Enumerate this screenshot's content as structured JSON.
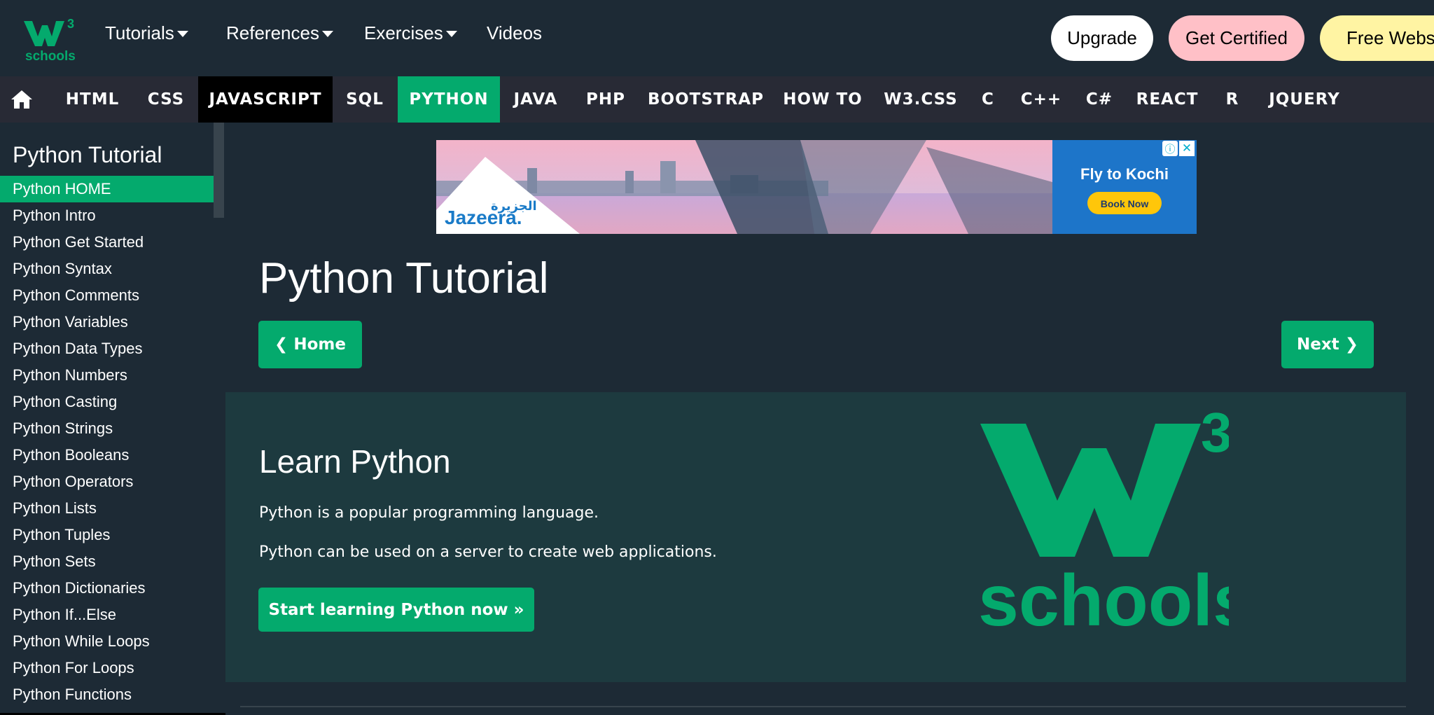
{
  "brand": {
    "logo_text": "schools",
    "logo_sup": "3",
    "logo_letter": "W",
    "accent": "#04aa6d"
  },
  "topnav": {
    "tutorials": "Tutorials",
    "references": "References",
    "exercises": "Exercises",
    "videos": "Videos",
    "upgrade": "Upgrade",
    "get_certified": "Get Certified",
    "free_website": "Free Websi"
  },
  "subnav": {
    "home_icon": "home-icon",
    "items": [
      "HTML",
      "CSS",
      "JAVASCRIPT",
      "SQL",
      "PYTHON",
      "JAVA",
      "PHP",
      "BOOTSTRAP",
      "HOW TO",
      "W3.CSS",
      "C",
      "C++",
      "C#",
      "REACT",
      "R",
      "JQUERY"
    ],
    "active": "PYTHON"
  },
  "sidebar": {
    "title": "Python Tutorial",
    "items": [
      "Python HOME",
      "Python Intro",
      "Python Get Started",
      "Python Syntax",
      "Python Comments",
      "Python Variables",
      "Python Data Types",
      "Python Numbers",
      "Python Casting",
      "Python Strings",
      "Python Booleans",
      "Python Operators",
      "Python Lists",
      "Python Tuples",
      "Python Sets",
      "Python Dictionaries",
      "Python If...Else",
      "Python While Loops",
      "Python For Loops",
      "Python Functions"
    ]
  },
  "ad": {
    "brand": "Jazeera.",
    "brand_arabic": "الجزيرة",
    "headline": "Fly to Kochi",
    "cta": "Book Now",
    "info_icon": "info-icon",
    "close_icon": "close-icon"
  },
  "main": {
    "title": "Python Tutorial",
    "prev_label": "Home",
    "next_label": "Next",
    "hero_title": "Learn Python",
    "hero_p1": "Python is a popular programming language.",
    "hero_p2": "Python can be used on a server to create web applications.",
    "start_button": "Start learning Python now »"
  }
}
